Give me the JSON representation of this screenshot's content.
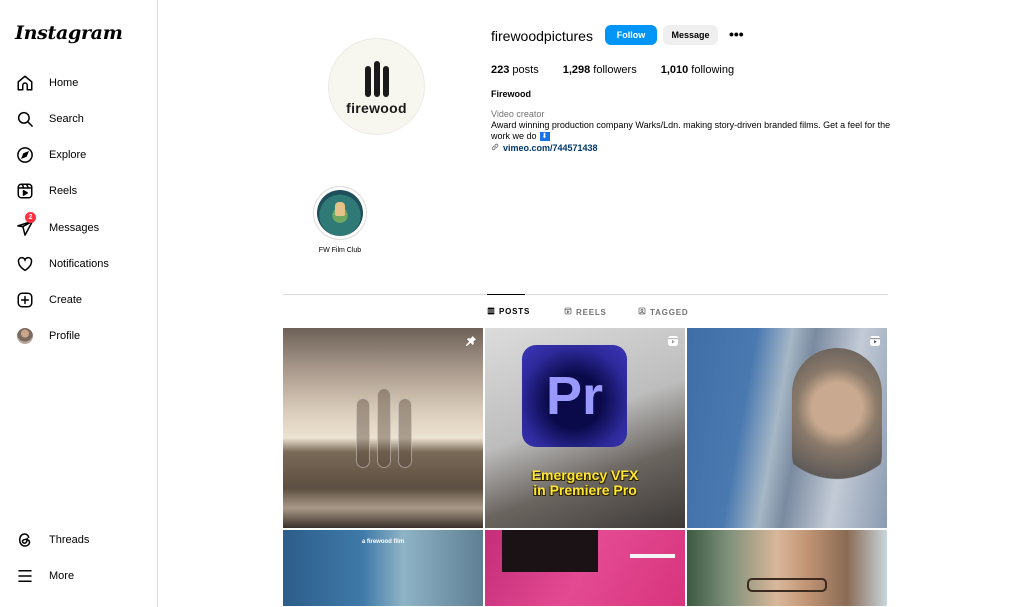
{
  "app": {
    "logo": "Instagram"
  },
  "sidebar": {
    "items": [
      {
        "label": "Home",
        "icon": "home-icon"
      },
      {
        "label": "Search",
        "icon": "search-icon"
      },
      {
        "label": "Explore",
        "icon": "explore-compass-icon"
      },
      {
        "label": "Reels",
        "icon": "reels-icon"
      },
      {
        "label": "Messages",
        "icon": "messages-paper-plane-icon",
        "badge": "2"
      },
      {
        "label": "Notifications",
        "icon": "heart-icon"
      },
      {
        "label": "Create",
        "icon": "create-plus-icon"
      },
      {
        "label": "Profile",
        "icon": "profile-avatar"
      }
    ],
    "bottom": [
      {
        "label": "Threads",
        "icon": "threads-icon"
      },
      {
        "label": "More",
        "icon": "hamburger-menu-icon"
      }
    ]
  },
  "profile": {
    "avatar_text": "firewood",
    "username": "firewoodpictures",
    "follow_label": "Follow",
    "message_label": "Message",
    "more_label": "•••",
    "stats": {
      "posts_count": "223",
      "posts_label": " posts",
      "followers_count": "1,298",
      "followers_label": " followers",
      "following_count": "1,010",
      "following_label": " following"
    },
    "full_name": "Firewood",
    "category": "Video creator",
    "bio_line": "Award winning production company Warks/Ldn. making story-driven branded films. Get a feel for the work we do",
    "bio_emoji": "⬇",
    "link_icon": "🔗",
    "link": "vimeo.com/744571438"
  },
  "highlights": [
    {
      "label": "FW Film Club"
    }
  ],
  "tabs": [
    {
      "label": "POSTS",
      "icon": "grid-icon",
      "active": true
    },
    {
      "label": "REELS",
      "icon": "reels-icon",
      "active": false
    },
    {
      "label": "TAGGED",
      "icon": "tagged-icon",
      "active": false
    }
  ],
  "posts": [
    {
      "type": "pinned",
      "icon": "pin-icon",
      "description": "Firewood logo over sunset landscape"
    },
    {
      "type": "reel",
      "icon": "reel-icon",
      "overlay_logo": "Pr",
      "caption_line1": "Emergency VFX",
      "caption_line2": "in Premiere Pro"
    },
    {
      "type": "reel",
      "icon": "reel-icon",
      "description": "Hospital scene with nurse and patient"
    },
    {
      "type": "post",
      "caption": "a firewood film"
    },
    {
      "type": "post",
      "description": "Pink studio with softbox and camera"
    },
    {
      "type": "post",
      "description": "Man with glasses on phone"
    }
  ]
}
